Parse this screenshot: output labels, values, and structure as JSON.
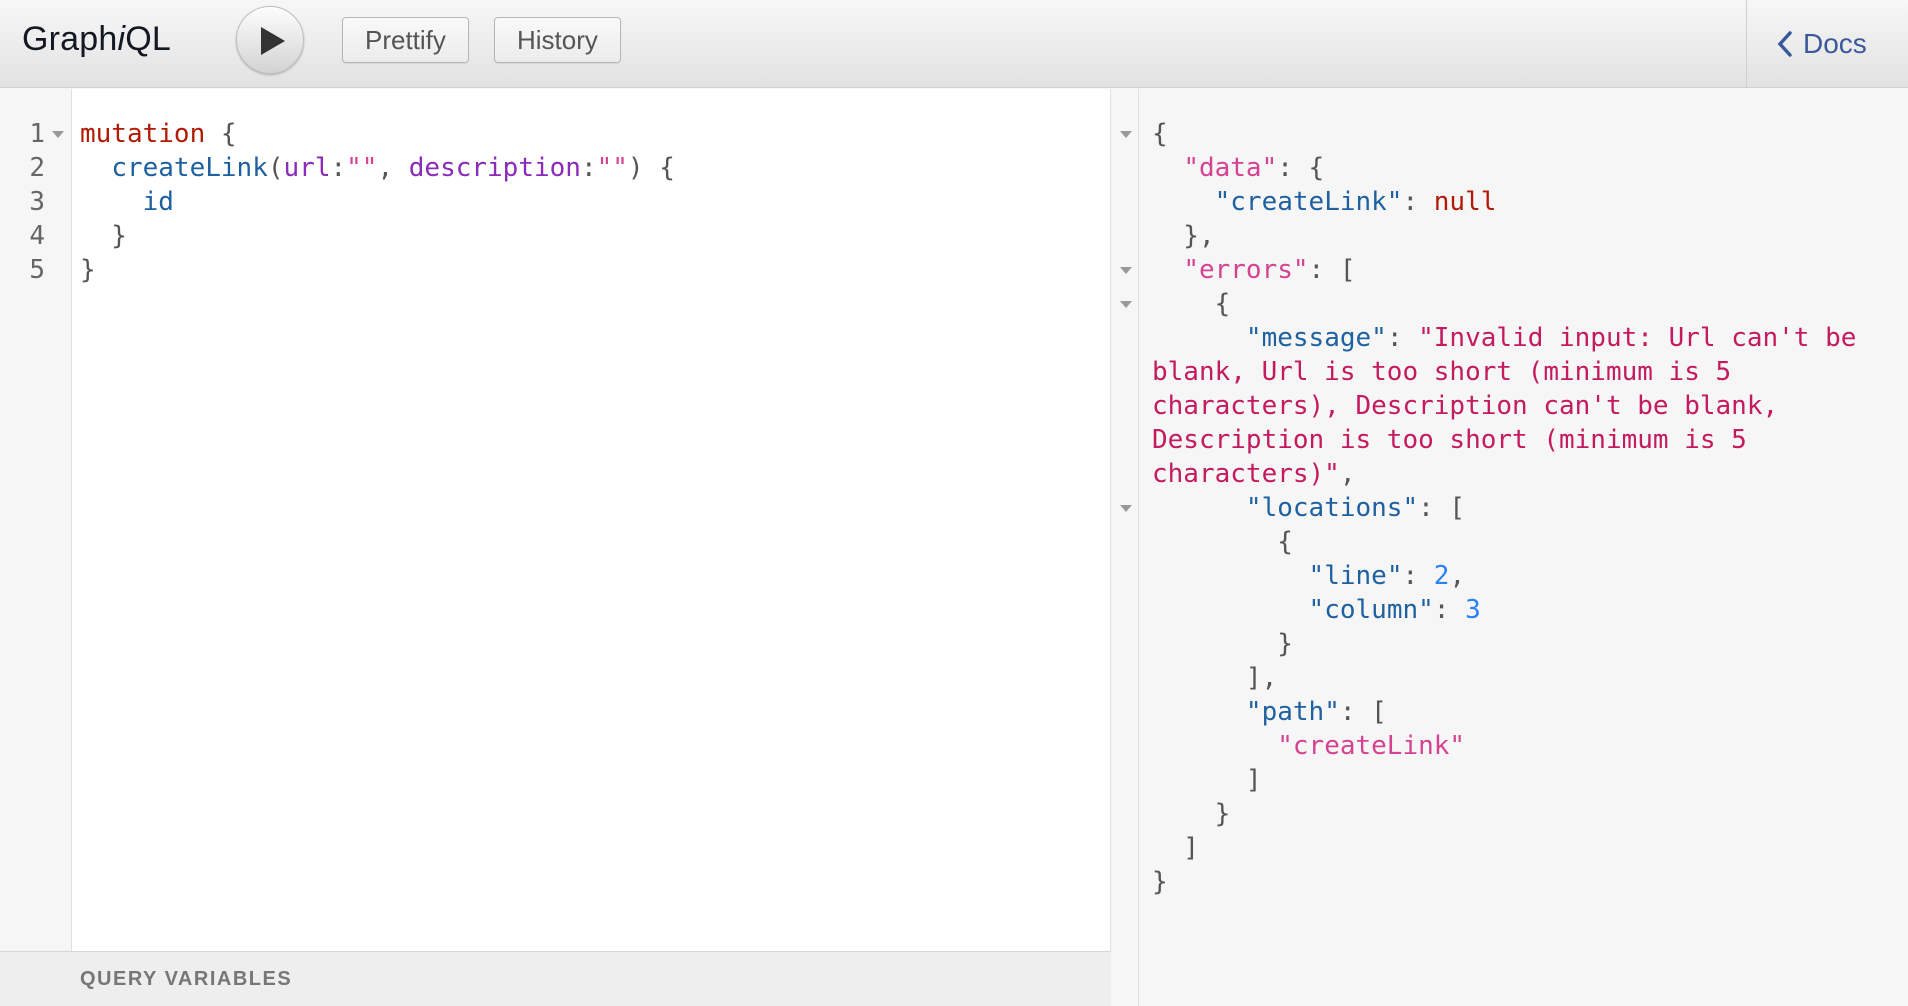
{
  "header": {
    "title_prefix": "Graph",
    "title_italic": "i",
    "title_suffix": "QL",
    "prettify_label": "Prettify",
    "history_label": "History",
    "docs_label": "Docs"
  },
  "editor": {
    "line_numbers": [
      "1",
      "2",
      "3",
      "4",
      "5"
    ],
    "lines": [
      [
        {
          "t": "mutation",
          "c": "kw"
        },
        {
          "t": " {",
          "c": "pun"
        }
      ],
      [
        {
          "t": "  ",
          "c": "pun"
        },
        {
          "t": "createLink",
          "c": "def"
        },
        {
          "t": "(",
          "c": "pun"
        },
        {
          "t": "url",
          "c": "attr"
        },
        {
          "t": ":",
          "c": "pun"
        },
        {
          "t": "\"\"",
          "c": "str"
        },
        {
          "t": ", ",
          "c": "pun"
        },
        {
          "t": "description",
          "c": "attr"
        },
        {
          "t": ":",
          "c": "pun"
        },
        {
          "t": "\"\"",
          "c": "str"
        },
        {
          "t": ") {",
          "c": "pun"
        }
      ],
      [
        {
          "t": "    ",
          "c": "pun"
        },
        {
          "t": "id",
          "c": "def"
        }
      ],
      [
        {
          "t": "  }",
          "c": "pun"
        }
      ],
      [
        {
          "t": "}",
          "c": "pun"
        }
      ]
    ]
  },
  "query_variables_label": "QUERY VARIABLES",
  "result": {
    "lines": [
      [
        {
          "t": "{",
          "c": "pun"
        }
      ],
      [
        {
          "t": "  ",
          "c": "pun"
        },
        {
          "t": "\"data\"",
          "c": "kstr"
        },
        {
          "t": ": {",
          "c": "pun"
        }
      ],
      [
        {
          "t": "    ",
          "c": "pun"
        },
        {
          "t": "\"createLink\"",
          "c": "key"
        },
        {
          "t": ": ",
          "c": "pun"
        },
        {
          "t": "null",
          "c": "jnull"
        }
      ],
      [
        {
          "t": "  },",
          "c": "pun"
        }
      ],
      [
        {
          "t": "  ",
          "c": "pun"
        },
        {
          "t": "\"errors\"",
          "c": "kstr"
        },
        {
          "t": ": [",
          "c": "pun"
        }
      ],
      [
        {
          "t": "    {",
          "c": "pun"
        }
      ],
      [
        {
          "t": "      ",
          "c": "pun"
        },
        {
          "t": "\"message\"",
          "c": "key"
        },
        {
          "t": ": ",
          "c": "pun"
        },
        {
          "t": "\"Invalid input: Url can't be",
          "c": "err"
        }
      ],
      [
        {
          "t": "blank, Url is too short (minimum is 5",
          "c": "err"
        }
      ],
      [
        {
          "t": "characters), Description can't be blank,",
          "c": "err"
        }
      ],
      [
        {
          "t": "Description is too short (minimum is 5",
          "c": "err"
        }
      ],
      [
        {
          "t": "characters)\"",
          "c": "err"
        },
        {
          "t": ",",
          "c": "pun"
        }
      ],
      [
        {
          "t": "      ",
          "c": "pun"
        },
        {
          "t": "\"locations\"",
          "c": "key"
        },
        {
          "t": ": [",
          "c": "pun"
        }
      ],
      [
        {
          "t": "        {",
          "c": "pun"
        }
      ],
      [
        {
          "t": "          ",
          "c": "pun"
        },
        {
          "t": "\"line\"",
          "c": "key"
        },
        {
          "t": ": ",
          "c": "pun"
        },
        {
          "t": "2",
          "c": "num"
        },
        {
          "t": ",",
          "c": "pun"
        }
      ],
      [
        {
          "t": "          ",
          "c": "pun"
        },
        {
          "t": "\"column\"",
          "c": "key"
        },
        {
          "t": ": ",
          "c": "pun"
        },
        {
          "t": "3",
          "c": "num"
        }
      ],
      [
        {
          "t": "        }",
          "c": "pun"
        }
      ],
      [
        {
          "t": "      ],",
          "c": "pun"
        }
      ],
      [
        {
          "t": "      ",
          "c": "pun"
        },
        {
          "t": "\"path\"",
          "c": "key"
        },
        {
          "t": ": [",
          "c": "pun"
        }
      ],
      [
        {
          "t": "        ",
          "c": "pun"
        },
        {
          "t": "\"createLink\"",
          "c": "kstr"
        }
      ],
      [
        {
          "t": "      ]",
          "c": "pun"
        }
      ],
      [
        {
          "t": "    }",
          "c": "pun"
        }
      ],
      [
        {
          "t": "  ]",
          "c": "pun"
        }
      ],
      [
        {
          "t": "}",
          "c": "pun"
        }
      ]
    ]
  }
}
